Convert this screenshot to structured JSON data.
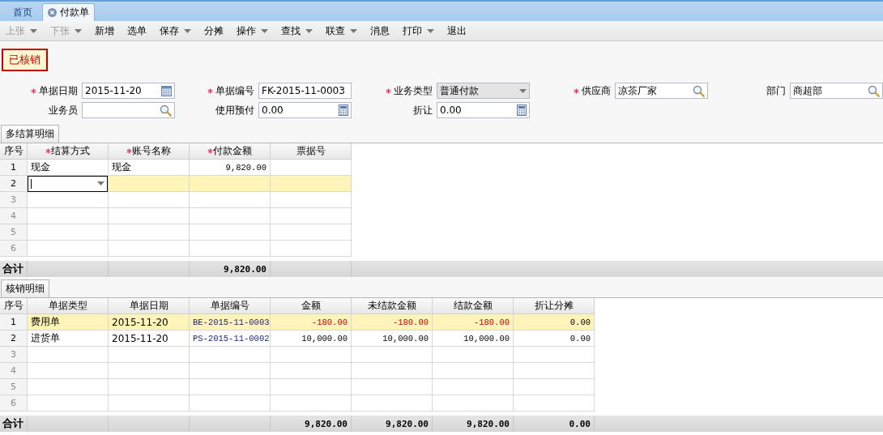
{
  "tabs": [
    {
      "label": "首页",
      "selected": false,
      "closable": false
    },
    {
      "label": "付款单",
      "selected": true,
      "closable": true
    }
  ],
  "toolbar": [
    {
      "label": "上张",
      "disabled": true,
      "menu": true
    },
    {
      "label": "下张",
      "disabled": true,
      "menu": true
    },
    {
      "label": "新增",
      "disabled": false,
      "menu": false
    },
    {
      "label": "选单",
      "disabled": false,
      "menu": false
    },
    {
      "label": "保存",
      "disabled": false,
      "menu": true
    },
    {
      "label": "分摊",
      "disabled": false,
      "menu": false
    },
    {
      "label": "操作",
      "disabled": false,
      "menu": true
    },
    {
      "label": "查找",
      "disabled": false,
      "menu": true
    },
    {
      "label": "联查",
      "disabled": false,
      "menu": true
    },
    {
      "label": "消息",
      "disabled": false,
      "menu": false
    },
    {
      "label": "打印",
      "disabled": false,
      "menu": true
    },
    {
      "label": "退出",
      "disabled": false,
      "menu": false
    }
  ],
  "status_badge": "已核销",
  "form": [
    [
      {
        "label": "单据日期",
        "required": true,
        "value": "2015-11-20",
        "kind": "calendar",
        "disabled": false
      },
      {
        "label": "单据编号",
        "required": true,
        "value": "FK-2015-11-0003",
        "kind": "plain",
        "disabled": false
      },
      {
        "label": "业务类型",
        "required": true,
        "value": "普通付款",
        "kind": "dropdown",
        "disabled": true
      },
      {
        "label": "供应商",
        "required": true,
        "value": "凉茶厂家",
        "kind": "search",
        "disabled": false
      },
      {
        "label": "部门",
        "required": false,
        "value": "商超部",
        "kind": "search",
        "disabled": false
      }
    ],
    [
      {
        "label": "业务员",
        "required": false,
        "kind": "search",
        "disabled": false
      },
      {
        "label": "使用预付",
        "required": false,
        "value": "0.00",
        "kind": "calculator",
        "disabled": false
      },
      {
        "label": "折让",
        "required": false,
        "value": "0.00",
        "kind": "calculator",
        "disabled": false
      }
    ]
  ],
  "sections": [
    {
      "title": "多结算明细",
      "no_header": "序号",
      "columns": [
        {
          "label": "结算方式",
          "required": true,
          "kind": "text"
        },
        {
          "label": "账号名称",
          "required": true,
          "kind": "text"
        },
        {
          "label": "付款金额",
          "required": true,
          "kind": "amount",
          "total": "9,820.00"
        },
        {
          "label": "票据号",
          "required": false,
          "kind": "text"
        }
      ],
      "rows": [
        {
          "no": "1",
          "selected": false,
          "editing": false,
          "cells": [
            "现金",
            "现金",
            "9,820.00",
            null
          ]
        },
        {
          "no": "2",
          "selected": true,
          "editing": true,
          "cells": [
            null,
            null,
            null,
            null
          ]
        },
        {
          "no": "3",
          "selected": false
        },
        {
          "no": "4",
          "selected": false
        },
        {
          "no": "5",
          "selected": false
        },
        {
          "no": "6",
          "selected": false
        }
      ],
      "total_label": "合计"
    },
    {
      "title": "核销明细",
      "no_header": "序号",
      "columns": [
        {
          "label": "单据类型",
          "required": false,
          "kind": "text"
        },
        {
          "label": "单据日期",
          "required": false,
          "kind": "text"
        },
        {
          "label": "单据编号",
          "required": false,
          "kind": "link"
        },
        {
          "label": "金额",
          "required": false,
          "kind": "amount",
          "total": "9,820.00"
        },
        {
          "label": "未结款金额",
          "required": false,
          "kind": "amount",
          "total": "9,820.00"
        },
        {
          "label": "结款金额",
          "required": false,
          "kind": "amount",
          "total": "9,820.00"
        },
        {
          "label": "折让分摊",
          "required": false,
          "kind": "plainamount",
          "total": "0.00"
        }
      ],
      "rows": [
        {
          "no": "1",
          "selected": true,
          "negative": true,
          "cells": [
            "费用单",
            "2015-11-20",
            "BE-2015-11-0003",
            "-180.00",
            "-180.00",
            "-180.00",
            "0.00"
          ]
        },
        {
          "no": "2",
          "selected": false,
          "negative": false,
          "cells": [
            "进货单",
            "2015-11-20",
            "PS-2015-11-0002",
            "10,000.00",
            "10,000.00",
            "10,000.00",
            "0.00"
          ]
        },
        {
          "no": "3",
          "selected": false
        },
        {
          "no": "4",
          "selected": false
        },
        {
          "no": "5",
          "selected": false
        },
        {
          "no": "6",
          "selected": false
        }
      ],
      "total_label": "合计"
    }
  ]
}
